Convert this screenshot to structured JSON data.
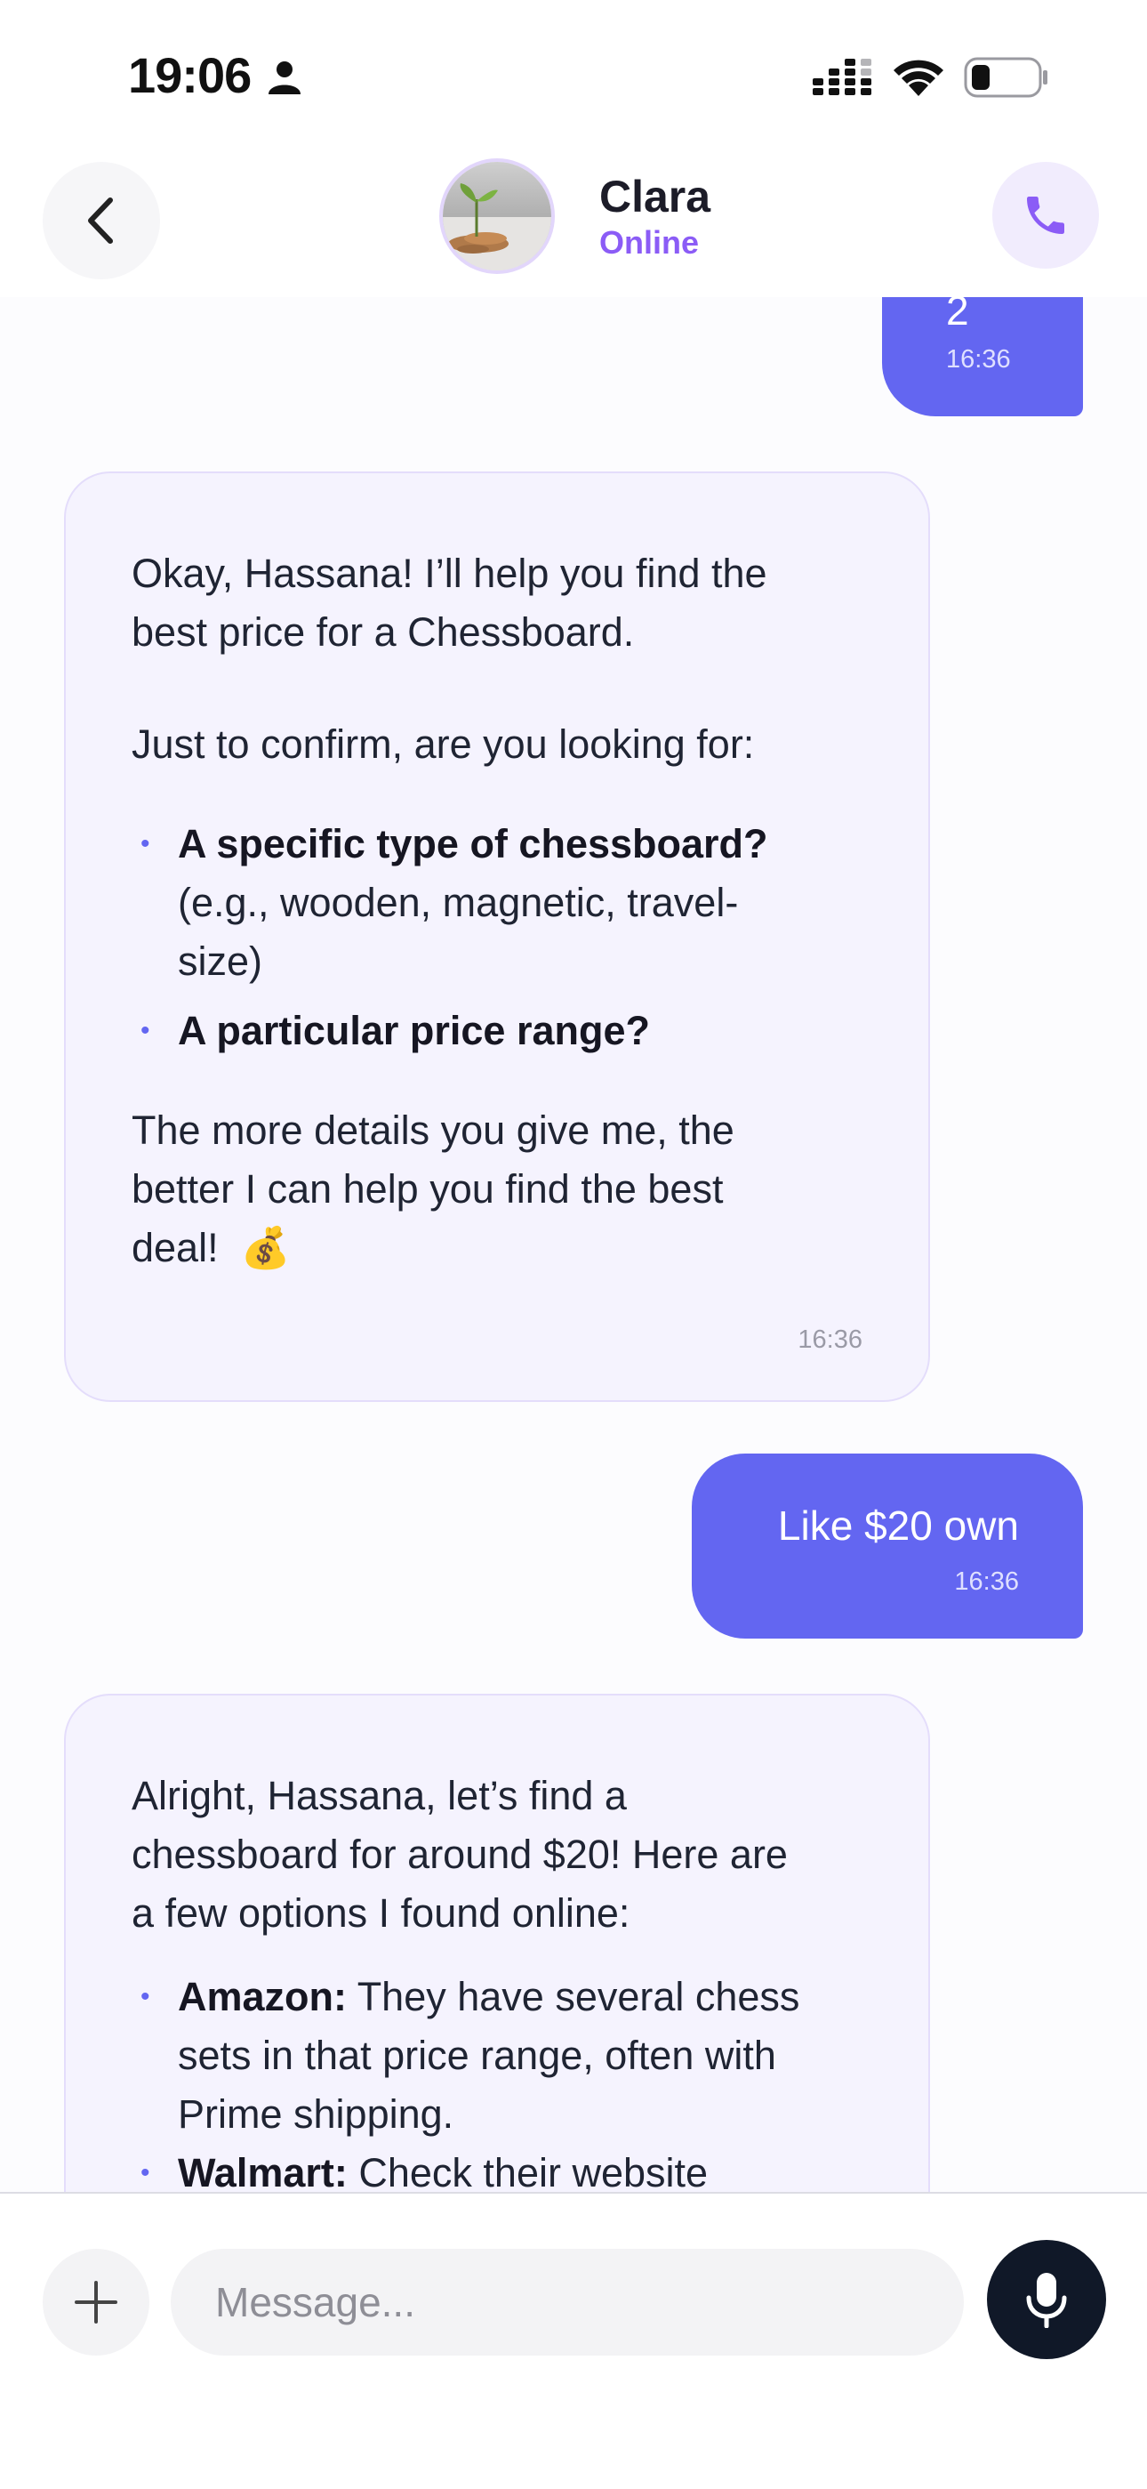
{
  "status_bar": {
    "time": "19:06"
  },
  "header": {
    "contact_name": "Clara",
    "contact_status": "Online",
    "accent": "#8b5cf6"
  },
  "messages": [
    {
      "role": "user",
      "text": "2",
      "time": "16:36"
    },
    {
      "role": "assistant",
      "intro": "Okay, Hassana! I’ll help you find the best price for a Chessboard.",
      "question": "Just to confirm, are you looking for:",
      "bullets": [
        {
          "bold": "A specific type of chessboard?",
          "rest_line1": "(e.g., wooden, magnetic, travel-",
          "rest_line2": "size)"
        },
        {
          "bold": "A particular price range?"
        }
      ],
      "outro_lines": [
        "The more details you give me, the",
        "better I can help you find the best",
        "deal!"
      ],
      "emoji": "💰",
      "time": "16:36"
    },
    {
      "role": "user",
      "text": "Like $20 own",
      "time": "16:36"
    },
    {
      "role": "assistant",
      "intro_lines": [
        "Alright, Hassana, let’s find a",
        "chessboard for around $20! Here are",
        "a few options I found online:"
      ],
      "bullets": [
        {
          "bold": "Amazon:",
          "rest_lines": [
            " They have several chess",
            "sets in that price range, often with",
            "Prime shipping."
          ]
        },
        {
          "bold": "Walmart:",
          "rest": " Check their website"
        }
      ]
    }
  ],
  "composer": {
    "placeholder": "Message..."
  },
  "colors": {
    "user_bubble": "#6366f1",
    "assistant_bubble": "#f5f3fe",
    "mic_button": "#101828"
  }
}
